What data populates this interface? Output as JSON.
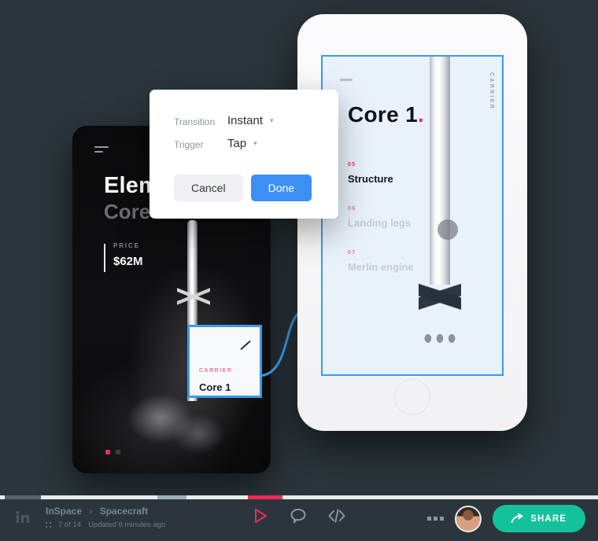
{
  "canvas": {
    "background_color": "#2b363c"
  },
  "dark_phone": {
    "menu_icon": "hamburger-menu-icon",
    "title": "Elements",
    "subtitle": "Core 1",
    "price_label": "PRICE",
    "price_value": "$62M",
    "page_dots": [
      "active",
      "inactive"
    ]
  },
  "white_phone": {
    "dash_icon": "dash-indicator-icon",
    "vertical_label": "CARRIER",
    "title": "Core 1",
    "title_accent": ".",
    "accent_color": "#ec2d56",
    "selection_border_color": "#3d9aec",
    "list": [
      {
        "num": "05",
        "name": "Structure",
        "state": "active"
      },
      {
        "num": "06",
        "name": "Landing legs",
        "state": "inactive"
      },
      {
        "num": "07",
        "name": "Merlin engine",
        "state": "inactive"
      }
    ]
  },
  "hotspot_card": {
    "category": "CARRIER",
    "name": "Core 1",
    "edit_icon": "hotspot-link-icon",
    "border_color": "#3d9aec"
  },
  "modal": {
    "rows": [
      {
        "label": "Transition",
        "value": "Instant"
      },
      {
        "label": "Trigger",
        "value": "Tap"
      }
    ],
    "caret": "▾",
    "cancel_label": "Cancel",
    "done_label": "Done",
    "done_color": "#3d8ff5"
  },
  "toolbar": {
    "logo": "invision-logo-icon",
    "breadcrumb": {
      "project": "InSpace",
      "separator": "›",
      "screen": "Spacecraft"
    },
    "meta": {
      "grid_icon": "grid-icon",
      "count": "7 of 14",
      "updated": "Updated 6 minutes ago"
    },
    "tools": [
      {
        "name": "play-icon",
        "glyph": "▷",
        "color": "#ec2d56"
      },
      {
        "name": "comment-icon",
        "glyph": "◯",
        "color": "#8b979f"
      },
      {
        "name": "code-icon",
        "glyph": "</>",
        "color": "#8b979f"
      }
    ],
    "more_icon": "more-options-icon",
    "avatar": "user-avatar",
    "share_label": "SHARE",
    "share_icon": "share-arrow-icon",
    "share_color": "#13c29a",
    "progress_color": "#ec2d56"
  }
}
